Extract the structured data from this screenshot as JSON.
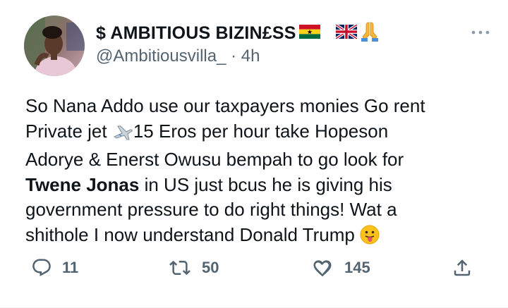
{
  "tweet": {
    "display_name": "$ AMBITIOUS BIZIN£SS",
    "flags": [
      "ghana-flag-icon",
      "uk-flag-icon",
      "folded-hands-icon"
    ],
    "handle": "@Ambitiousvilla_",
    "separator": "·",
    "time": "4h",
    "text": {
      "line1": "So Nana Addo use our taxpayers monies Go rent",
      "line2_before": "Private jet ",
      "line2_after": "15 Eros per hour take Hopeson",
      "line3": "Adorye & Enerst Owusu bempah to go look for",
      "line4_bold": "Twene Jonas",
      "line4_rest": " in US just bcus he is giving his",
      "line5": "government pressure to do right things! Wat a",
      "line6": "shithole I now understand Donald Trump "
    },
    "actions": {
      "replies": "11",
      "retweets": "50",
      "likes": "145"
    }
  },
  "colors": {
    "text": "#0f1419",
    "secondary": "#536471",
    "icon": "#536471"
  }
}
